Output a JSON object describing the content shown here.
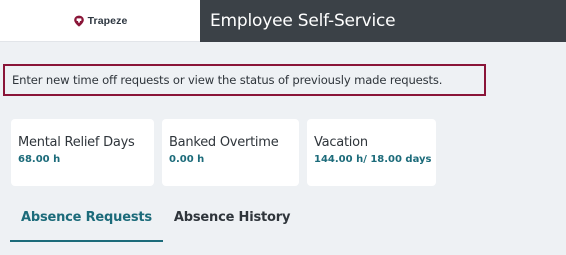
{
  "header": {
    "logo_text": "Trapeze",
    "app_title": "Employee Self-Service",
    "logo_icon": "location-pin-icon"
  },
  "intro": {
    "text": "Enter new time off requests or view the status of previously made requests."
  },
  "balances": [
    {
      "title": "Mental Relief Days",
      "value": "68.00 h"
    },
    {
      "title": "Banked Overtime",
      "value": "0.00 h"
    },
    {
      "title": "Vacation",
      "value": "144.00 h/ 18.00 days"
    }
  ],
  "tabs": [
    {
      "label": "Absence Requests",
      "active": true
    },
    {
      "label": "Absence History",
      "active": false
    }
  ],
  "colors": {
    "accent": "#1c6b7a",
    "highlight_border": "#8a1538",
    "header_dark": "#3b4147",
    "page_background": "#eef1f4",
    "logo_mark": "#8a1538"
  }
}
